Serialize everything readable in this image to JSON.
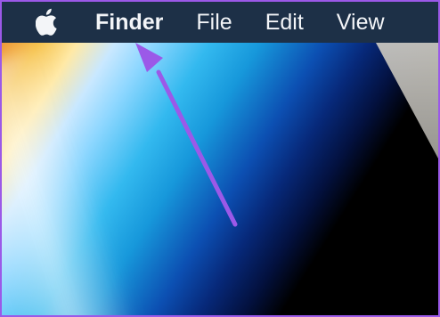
{
  "menubar": {
    "items": [
      {
        "label": "Finder"
      },
      {
        "label": "File"
      },
      {
        "label": "Edit"
      },
      {
        "label": "View"
      }
    ]
  },
  "colors": {
    "menubar_bg": "#1d3047",
    "menubar_text": "#f3f5f8",
    "arrow": "#9b59e8",
    "frame": "#9b59e8"
  },
  "icons": {
    "apple_menu": "apple-logo-icon",
    "annotation": "arrow-annotation-icon"
  }
}
